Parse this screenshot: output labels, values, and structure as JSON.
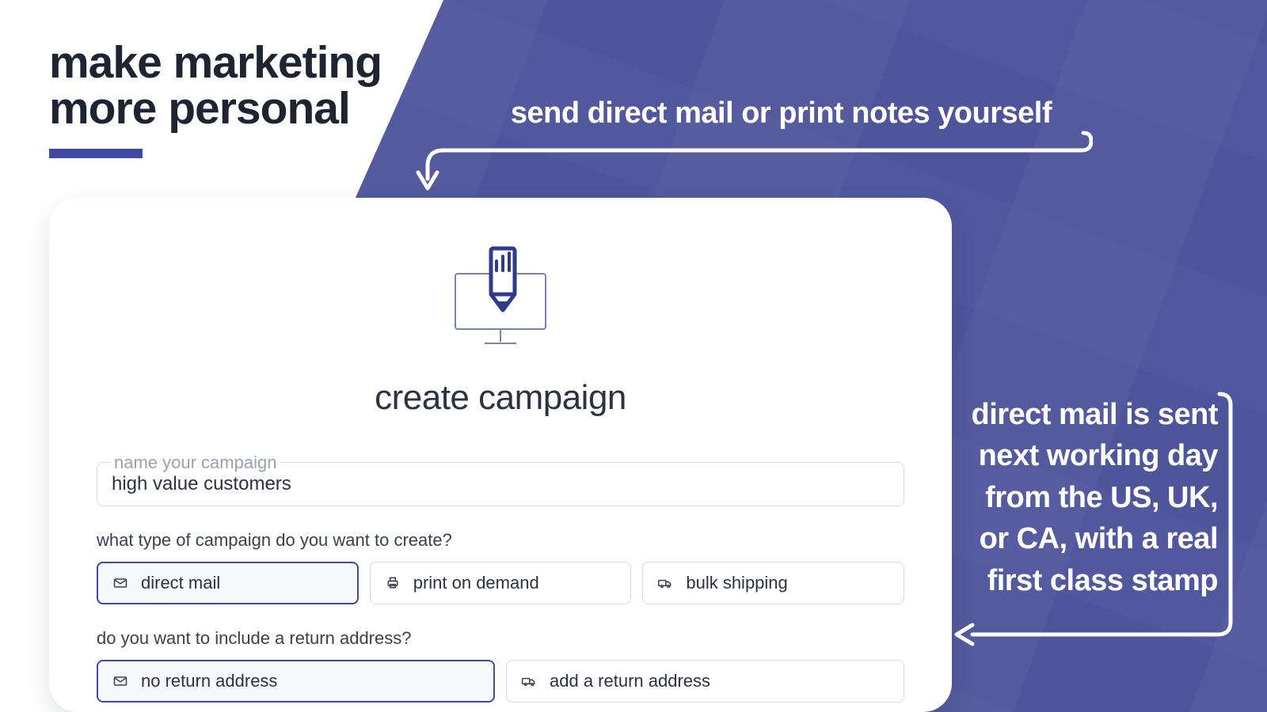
{
  "headline": {
    "line1": "make marketing",
    "line2": "more personal"
  },
  "callouts": {
    "top": "send direct mail or print notes yourself",
    "right": "direct mail is sent next working day from the US, UK, or CA, with a real first class stamp"
  },
  "card": {
    "title": "create campaign",
    "name_field": {
      "label": "name your campaign",
      "value": "high value customers"
    },
    "type_question": "what type of campaign do you want to create?",
    "type_options": [
      "direct mail",
      "print on demand",
      "bulk shipping"
    ],
    "type_selected": 0,
    "return_question": "do you want to include a return address?",
    "return_options": [
      "no return address",
      "add a return address"
    ],
    "return_selected": 0
  },
  "colors": {
    "accent": "#3f4aa3",
    "bg_blue": "#4e559b",
    "text": "#2c3244"
  }
}
